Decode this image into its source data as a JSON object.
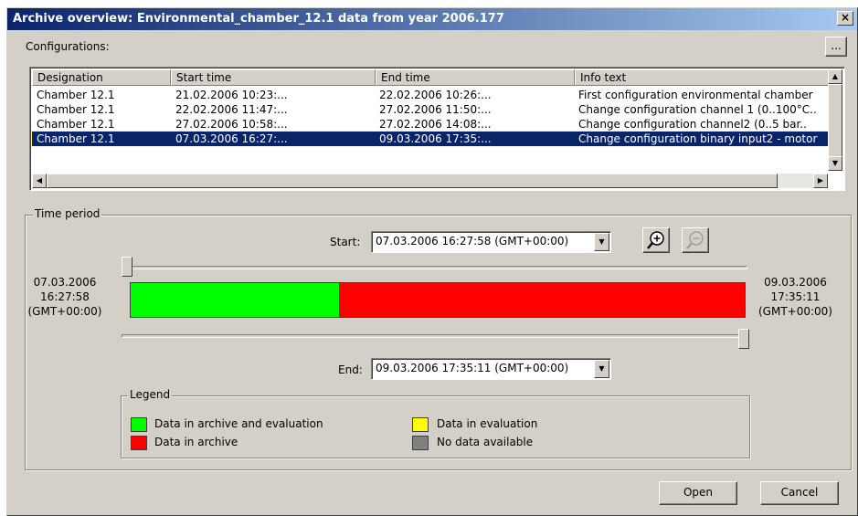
{
  "window": {
    "title": "Archive overview: Environmental_chamber_12.1 data from year 2006.177",
    "close_glyph": "×"
  },
  "configurations": {
    "label": "Configurations:",
    "more_button": "...",
    "columns": [
      "Designation",
      "Start time",
      "End time",
      "Info text"
    ],
    "rows": [
      {
        "designation": "Chamber 12.1",
        "start": "21.02.2006 10:23:...",
        "end": "22.02.2006 10:26:...",
        "info": "First configuration environmental chamber",
        "selected": false
      },
      {
        "designation": "Chamber 12.1",
        "start": "22.02.2006 11:47:...",
        "end": "27.02.2006 11:50:...",
        "info": "Change configuration channel 1 (0..100°C..",
        "selected": false
      },
      {
        "designation": "Chamber 12.1",
        "start": "27.02.2006 10:58:...",
        "end": "27.02.2006 14:08:...",
        "info": "Change configuration channel2 (0..5 bar..",
        "selected": false
      },
      {
        "designation": "Chamber 12.1",
        "start": "07.03.2006 16:27:...",
        "end": "09.03.2006 17:35:...",
        "info": "Change configuration binary input2 - motor",
        "selected": true
      }
    ]
  },
  "time_period": {
    "title": "Time period",
    "start_label": "Start:",
    "start_value": "07.03.2006 16:27:58   (GMT+00:00)",
    "end_label": "End:",
    "end_value": "09.03.2006 17:35:11   (GMT+00:00)",
    "left_date": "07.03.2006",
    "left_time": "16:27:58",
    "left_tz": "(GMT+00:00)",
    "right_date": "09.03.2006",
    "right_time": "17:35:11",
    "right_tz": "(GMT+00:00)",
    "bar_green_fraction": 0.34,
    "bar_colors": {
      "green": "#00ff00",
      "red": "#ff0000"
    }
  },
  "legend": {
    "title": "Legend",
    "items": [
      {
        "label": "Data in archive and evaluation",
        "color": "#00ff00"
      },
      {
        "label": "Data in archive",
        "color": "#ff0000"
      },
      {
        "label": "Data in evaluation",
        "color": "#ffff00"
      },
      {
        "label": "No data available",
        "color": "#808080"
      }
    ]
  },
  "buttons": {
    "open": "Open",
    "cancel": "Cancel"
  }
}
